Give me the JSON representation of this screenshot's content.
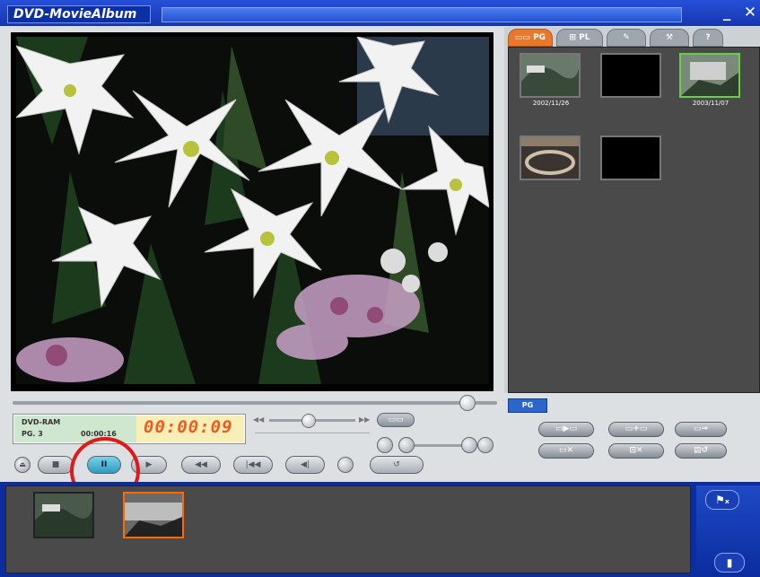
{
  "window": {
    "title": "DVD-MovieAlbum",
    "minimize_glyph": "_",
    "close_glyph": "✕"
  },
  "tabs": [
    {
      "label": "PG",
      "active": true,
      "icon": "filmstrip-icon"
    },
    {
      "label": "PL",
      "active": false,
      "icon": "playlist-icon"
    },
    {
      "label": "",
      "active": false,
      "icon": "pencil-icon"
    },
    {
      "label": "",
      "active": false,
      "icon": "tools-icon"
    },
    {
      "label": "?",
      "active": false,
      "icon": "help-icon"
    }
  ],
  "thumbnails": [
    {
      "caption": "2002/11/26",
      "selected": false
    },
    {
      "caption": "",
      "selected": false
    },
    {
      "caption": "2003/11/07",
      "selected": true
    },
    {
      "caption": "",
      "selected": false
    },
    {
      "caption": "",
      "selected": false
    }
  ],
  "display": {
    "media": "DVD-RAM",
    "program": "PG. 3",
    "counter": "00:00:16",
    "timecode": "00:00:09"
  },
  "transport": {
    "eject_icon": "eject-icon",
    "stop_icon": "stop-icon",
    "pause_label": "II",
    "play_icon": "play-icon",
    "rewind": "◀◀",
    "fast_forward": "▶▶",
    "prev_chapter": "|◀◀",
    "next_chapter": "▶▶|",
    "frame_back": "◀|",
    "frame_forward": "|▶",
    "step": "|▶",
    "repeat_icon": "repeat-icon"
  },
  "edit_panel": {
    "badge": "PG",
    "buttons": [
      "▭▶▭",
      "▭+▭",
      "▭⊸",
      "▭✕",
      "⊡✕",
      "▤↺"
    ]
  },
  "timeline": {
    "clips": [
      {
        "selected": false
      },
      {
        "selected": true
      }
    ],
    "side_buttons": [
      "⚑ₓ",
      "▮"
    ]
  },
  "colors": {
    "accent": "#e7782c",
    "timecode": "#ef5a20",
    "selection_green": "#68d048",
    "highlight_red": "#e01818"
  }
}
